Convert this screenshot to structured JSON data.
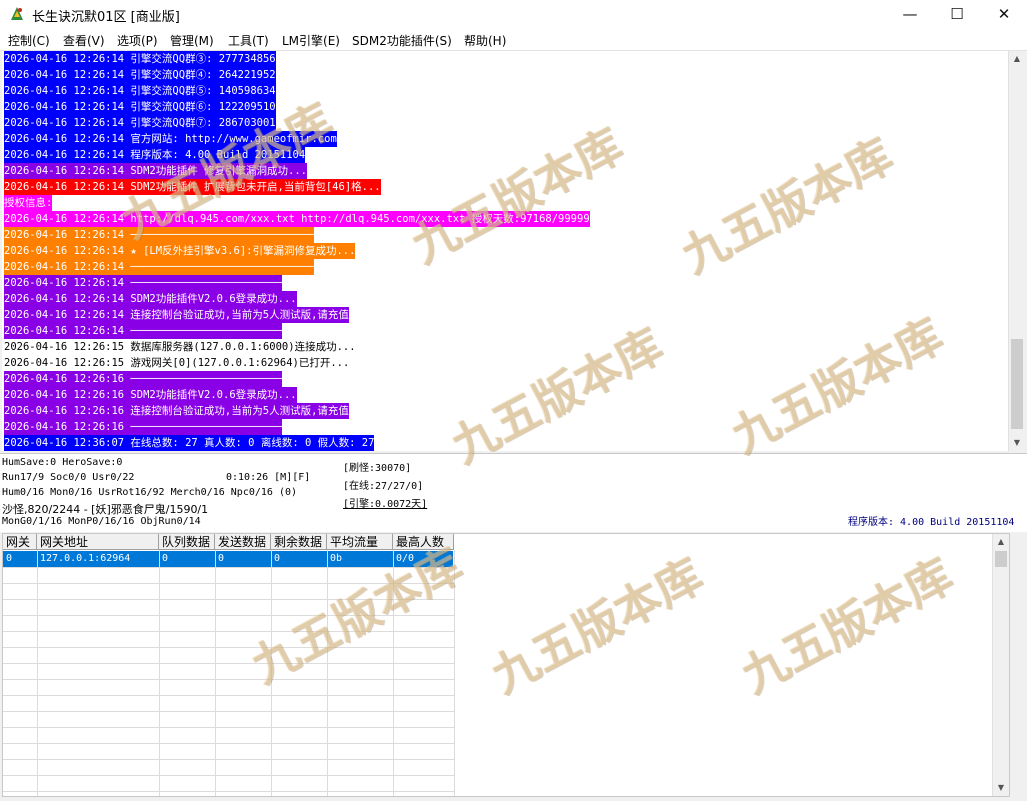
{
  "window": {
    "title": "长生诀沉默01区 [商业版]",
    "controls": {
      "minimize": "—",
      "maximize": "☐",
      "close": "✕"
    }
  },
  "menu": [
    "控制(C)",
    "查看(V)",
    "选项(P)",
    "管理(M)",
    "工具(T)",
    "LM引擎(E)",
    "SDM2功能插件(S)",
    "帮助(H)"
  ],
  "log": [
    {
      "text": "2026-04-16 12:26:14 引擎交流QQ群③: 277734856",
      "bg": "#0000ff",
      "fg": "#ffffff"
    },
    {
      "text": "2026-04-16 12:26:14 引擎交流QQ群④: 264221952",
      "bg": "#0000ff",
      "fg": "#ffffff"
    },
    {
      "text": "2026-04-16 12:26:14 引擎交流QQ群⑤: 140598634",
      "bg": "#0000ff",
      "fg": "#ffffff"
    },
    {
      "text": "2026-04-16 12:26:14 引擎交流QQ群⑥: 122209510",
      "bg": "#0000ff",
      "fg": "#ffffff"
    },
    {
      "text": "2026-04-16 12:26:14 引擎交流QQ群⑦: 286703001",
      "bg": "#0000ff",
      "fg": "#ffffff"
    },
    {
      "text": "2026-04-16 12:26:14 官方网站: http://www.gameofmir.com",
      "bg": "#0000ff",
      "fg": "#ffffff"
    },
    {
      "text": "2026-04-16 12:26:14 程序版本: 4.00 Build 20151104",
      "bg": "#0000ff",
      "fg": "#ffffff"
    },
    {
      "text": "2026-04-16 12:26:14 SDM2功能插件 修复引擎漏洞成功...",
      "bg": "#8a00e6",
      "fg": "#ffffff"
    },
    {
      "text": "2026-04-16 12:26:14 SDM2功能插件 扩展背包未开启,当前背包[46]格...",
      "bg": "#ff0000",
      "fg": "#ffffff"
    },
    {
      "text": "授权信息:",
      "bg": "#ff00ff",
      "fg": "#ffffff"
    },
    {
      "text": "2026-04-16 12:26:14 http://dlq.945.com/xxx.txt http://dlq.945.com/xxx.txt 授权天数:97168/99999",
      "bg": "#ff00ff",
      "fg": "#ffffff"
    },
    {
      "text": "2026-04-16 12:26:14 ─────────────────────────────",
      "bg": "#ff8000",
      "fg": "#ffffff"
    },
    {
      "text": "2026-04-16 12:26:14 ★ [LM反外挂引擎v3.6]:引擎漏洞修复成功...",
      "bg": "#ff8000",
      "fg": "#ffffff"
    },
    {
      "text": "2026-04-16 12:26:14 ─────────────────────────────",
      "bg": "#ff8000",
      "fg": "#ffffff"
    },
    {
      "text": "2026-04-16 12:26:14 ────────────────────────",
      "bg": "#8a00e6",
      "fg": "#ffffff"
    },
    {
      "text": "2026-04-16 12:26:14 SDM2功能插件V2.0.6登录成功...",
      "bg": "#8a00e6",
      "fg": "#ffffff"
    },
    {
      "text": "2026-04-16 12:26:14 连接控制台验证成功,当前为5人测试版,请充值",
      "bg": "#8a00e6",
      "fg": "#ffffff"
    },
    {
      "text": "2026-04-16 12:26:14 ────────────────────────",
      "bg": "#8a00e6",
      "fg": "#ffffff"
    },
    {
      "text": "2026-04-16 12:26:15 数据库服务器(127.0.0.1:6000)连接成功...",
      "bg": "",
      "fg": "#000000"
    },
    {
      "text": "2026-04-16 12:26:15 游戏网关[0](127.0.0.1:62964)已打开...",
      "bg": "",
      "fg": "#000000"
    },
    {
      "text": "2026-04-16 12:26:16 ────────────────────────",
      "bg": "#8a00e6",
      "fg": "#ffffff"
    },
    {
      "text": "2026-04-16 12:26:16 SDM2功能插件V2.0.6登录成功...",
      "bg": "#8a00e6",
      "fg": "#ffffff"
    },
    {
      "text": "2026-04-16 12:26:16 连接控制台验证成功,当前为5人测试版,请充值",
      "bg": "#8a00e6",
      "fg": "#ffffff"
    },
    {
      "text": "2026-04-16 12:26:16 ────────────────────────",
      "bg": "#8a00e6",
      "fg": "#ffffff"
    },
    {
      "text": "2026-04-16 12:36:07 在线总数: 27 真人数: 0 离线数: 0 假人数: 27",
      "bg": "#0000ff",
      "fg": "#ffffff"
    }
  ],
  "status": {
    "line1": "HumSave:0 HeroSave:0",
    "line2a": "Run17/9 Soc0/0 Usr0/22",
    "line2b": "0:10:26 [M][F]",
    "line3": "Hum0/16 Mon0/16 UsrRot16/92 Merch0/16 Npc0/16 (0)",
    "line4": "沙怪,820/2244 - [妖]邪恶食尸鬼/1590/1",
    "line5": "MonG0/1/16 MonP0/16/16 ObjRun0/14",
    "refresh": "[刷怪:30070]",
    "online": "[在线:27/27/0]",
    "engine": "[引擎:0.0072天]",
    "version": "程序版本: 4.00 Build 20151104"
  },
  "gateways": {
    "headers": [
      "网关",
      "网关地址",
      "队列数据",
      "发送数据",
      "剩余数据",
      "平均流量",
      "最高人数"
    ],
    "rows": [
      [
        "0",
        "127.0.0.1:62964",
        "0",
        "0",
        "0",
        "0b",
        "0/0"
      ]
    ]
  },
  "watermark": "九五版本库"
}
